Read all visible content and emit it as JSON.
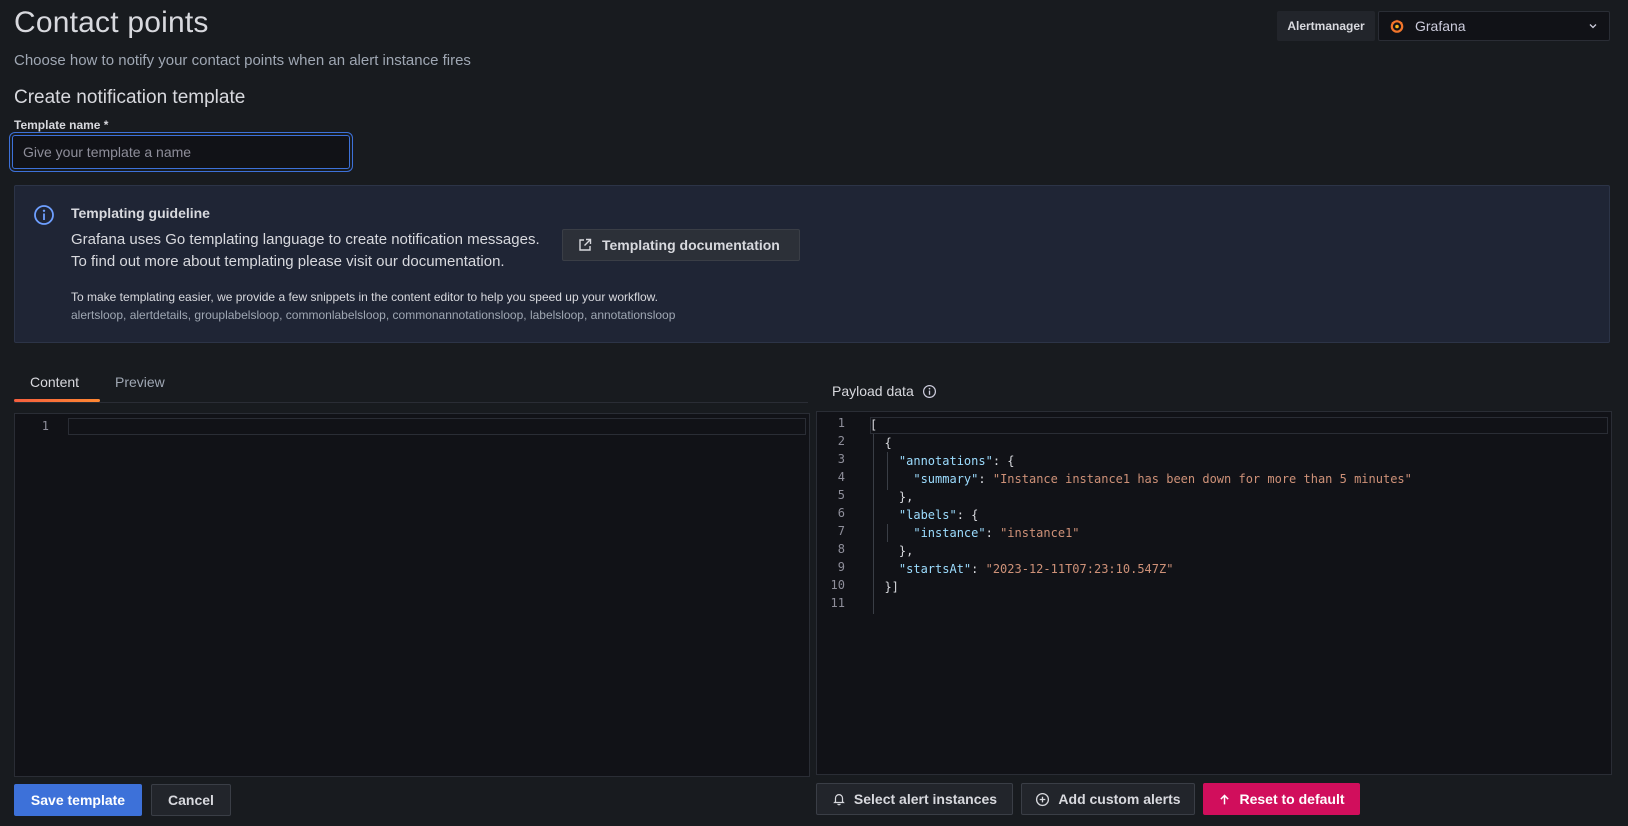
{
  "header": {
    "title": "Contact points",
    "subtitle": "Choose how to notify your contact points when an alert instance fires"
  },
  "alertmanager": {
    "label": "Alertmanager",
    "selected": "Grafana"
  },
  "form": {
    "section_title": "Create notification template",
    "name_label": "Template name *",
    "name_placeholder": "Give your template a name",
    "name_value": ""
  },
  "guideline": {
    "title": "Templating guideline",
    "line1": "Grafana uses Go templating language to create notification messages.",
    "line2": "To find out more about templating please visit our documentation.",
    "doc_button": "Templating documentation",
    "snippets_intro": "To make templating easier, we provide a few snippets in the content editor to help you speed up your workflow.",
    "snippets_list": "alertsloop, alertdetails, grouplabelsloop, commonlabelsloop, commonannotationsloop, labelsloop, annotationsloop"
  },
  "tabs": [
    {
      "label": "Content",
      "active": true
    },
    {
      "label": "Preview",
      "active": false
    }
  ],
  "content_editor": {
    "line_numbers": [
      "1"
    ]
  },
  "payload": {
    "title": "Payload data",
    "line_numbers": [
      "1",
      "2",
      "3",
      "4",
      "5",
      "6",
      "7",
      "8",
      "9",
      "10",
      "11"
    ],
    "lines": [
      [
        {
          "t": "p",
          "v": "["
        }
      ],
      [
        {
          "t": "p",
          "v": "  {"
        }
      ],
      [
        {
          "t": "p",
          "v": "    "
        },
        {
          "t": "k",
          "v": "\"annotations\""
        },
        {
          "t": "p",
          "v": ": {"
        }
      ],
      [
        {
          "t": "p",
          "v": "      "
        },
        {
          "t": "k",
          "v": "\"summary\""
        },
        {
          "t": "p",
          "v": ": "
        },
        {
          "t": "s",
          "v": "\"Instance instance1 has been down for more than 5 minutes\""
        }
      ],
      [
        {
          "t": "p",
          "v": "    },"
        }
      ],
      [
        {
          "t": "p",
          "v": "    "
        },
        {
          "t": "k",
          "v": "\"labels\""
        },
        {
          "t": "p",
          "v": ": {"
        }
      ],
      [
        {
          "t": "p",
          "v": "      "
        },
        {
          "t": "k",
          "v": "\"instance\""
        },
        {
          "t": "p",
          "v": ": "
        },
        {
          "t": "s",
          "v": "\"instance1\""
        }
      ],
      [
        {
          "t": "p",
          "v": "    },"
        }
      ],
      [
        {
          "t": "p",
          "v": "    "
        },
        {
          "t": "k",
          "v": "\"startsAt\""
        },
        {
          "t": "p",
          "v": ": "
        },
        {
          "t": "s",
          "v": "\"2023-12-11T07:23:10.547Z\""
        }
      ],
      [
        {
          "t": "p",
          "v": "  }]"
        }
      ],
      [
        {
          "t": "p",
          "v": ""
        }
      ]
    ]
  },
  "actions": {
    "save": "Save template",
    "cancel": "Cancel",
    "select_instances": "Select alert instances",
    "add_custom": "Add custom alerts",
    "reset": "Reset to default"
  },
  "colors": {
    "primary": "#3d71d9",
    "danger": "#d10e5c",
    "tab_accent": "#f55f3e",
    "json_key": "#9cdcfe",
    "json_string": "#ce9178"
  }
}
